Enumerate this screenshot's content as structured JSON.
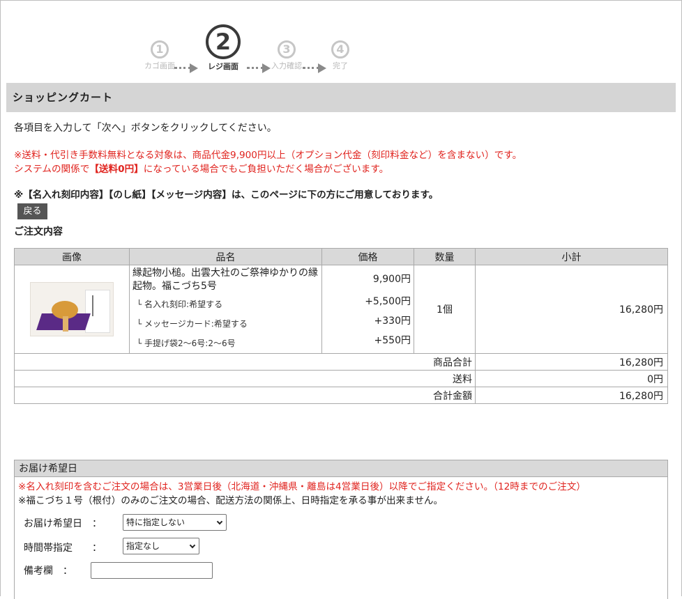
{
  "steps": [
    {
      "num": "1",
      "label": "カゴ画面"
    },
    {
      "num": "2",
      "label": "レジ画面"
    },
    {
      "num": "3",
      "label": "入力確認"
    },
    {
      "num": "4",
      "label": "完了"
    }
  ],
  "cart_title": "ショッピングカート",
  "instruction": "各項目を入力して「次へ」ボタンをクリックしてください。",
  "notice_line1": "※送料・代引き手数料無料となる対象は、商品代金9,900円以上（オプション代金（刻印料金など）を含まない）です。",
  "notice_line2_pre": "システムの関係で",
  "notice_line2_bold": "【送料0円】",
  "notice_line2_post": "になっている場合でもご負担いただく場合がございます。",
  "bold_notice": "※【名入れ刻印内容】【のし紙】【メッセージ内容】は、このページに下の方にご用意しております。",
  "back_button": "戻る",
  "order_title": "ご注文内容",
  "table": {
    "headers": [
      "画像",
      "品名",
      "価格",
      "数量",
      "小計"
    ],
    "product_name": "縁起物小槌。出雲大社のご祭神ゆかりの縁起物。福こづち5号",
    "base_price": "9,900円",
    "options": [
      {
        "label": "└ 名入れ刻印:希望する",
        "price": "+5,500円"
      },
      {
        "label": "└ メッセージカード:希望する",
        "price": "+330円"
      },
      {
        "label": "└ 手提げ袋2〜6号:2〜6号",
        "price": "+550円"
      }
    ],
    "quantity": "1個",
    "subtotal": "16,280円",
    "summary": [
      {
        "label": "商品合計",
        "value": "16,280円"
      },
      {
        "label": "送料",
        "value": "0円"
      },
      {
        "label": "合計金額",
        "value": "16,280円"
      }
    ]
  },
  "delivery": {
    "header": "お届け希望日",
    "note_red": "※名入れ刻印を含むご注文の場合は、3営業日後（北海道・沖縄県・離島は4営業日後）以降でご指定ください。（12時までのご注文）",
    "note_black": "※福こづち１号（根付）のみのご注文の場合、配送方法の関係上、日時指定を承る事が出来ません。",
    "date_label": "お届け希望日　：",
    "date_value": "特に指定しない",
    "time_label": "時間帯指定　　：",
    "time_value": "指定なし",
    "memo_label": "備考欄　：",
    "memo_value": ""
  }
}
